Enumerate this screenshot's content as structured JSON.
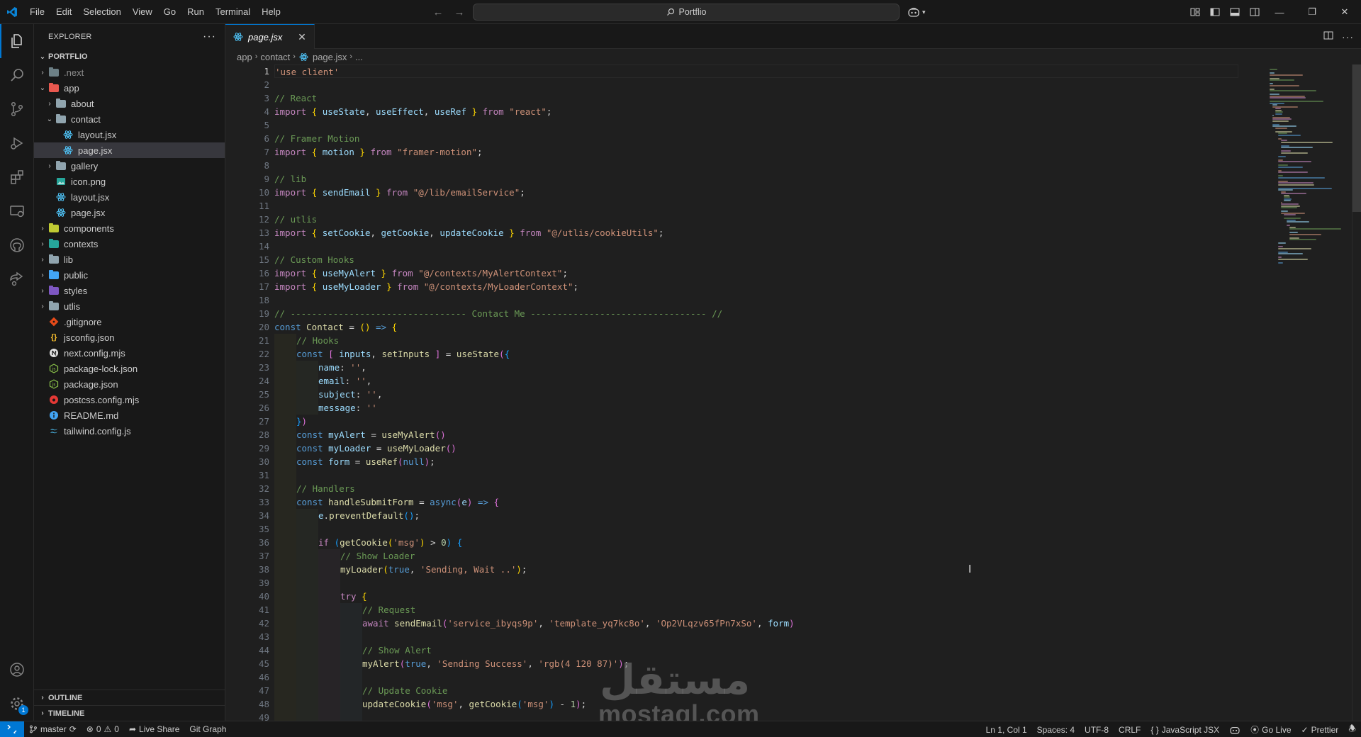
{
  "titlebar": {
    "menu": [
      "File",
      "Edit",
      "Selection",
      "View",
      "Go",
      "Run",
      "Terminal",
      "Help"
    ],
    "search": "Portflio"
  },
  "explorer": {
    "title": "EXPLORER",
    "more": "···",
    "project": "PORTFLIO",
    "tree": [
      {
        "name": ".next",
        "level": 0,
        "type": "folder",
        "color": "#6d8086",
        "chev": "right",
        "dim": true
      },
      {
        "name": "app",
        "level": 0,
        "type": "folder",
        "color": "#e8584f",
        "chev": "down"
      },
      {
        "name": "about",
        "level": 1,
        "type": "folder",
        "color": "#90a4ae",
        "chev": "right"
      },
      {
        "name": "contact",
        "level": 1,
        "type": "folder",
        "color": "#90a4ae",
        "chev": "down"
      },
      {
        "name": "layout.jsx",
        "level": 2,
        "type": "react"
      },
      {
        "name": "page.jsx",
        "level": 2,
        "type": "react",
        "selected": true
      },
      {
        "name": "gallery",
        "level": 1,
        "type": "folder",
        "color": "#90a4ae",
        "chev": "right"
      },
      {
        "name": "icon.png",
        "level": 1,
        "type": "image"
      },
      {
        "name": "layout.jsx",
        "level": 1,
        "type": "react"
      },
      {
        "name": "page.jsx",
        "level": 1,
        "type": "react"
      },
      {
        "name": "components",
        "level": 0,
        "type": "folder",
        "color": "#c0ca33",
        "chev": "right"
      },
      {
        "name": "contexts",
        "level": 0,
        "type": "folder",
        "color": "#26a69a",
        "chev": "right"
      },
      {
        "name": "lib",
        "level": 0,
        "type": "folder",
        "color": "#90a4ae",
        "chev": "right"
      },
      {
        "name": "public",
        "level": 0,
        "type": "folder",
        "color": "#42a5f5",
        "chev": "right"
      },
      {
        "name": "styles",
        "level": 0,
        "type": "folder",
        "color": "#7e57c2",
        "chev": "right"
      },
      {
        "name": "utlis",
        "level": 0,
        "type": "folder",
        "color": "#90a4ae",
        "chev": "right"
      },
      {
        "name": ".gitignore",
        "level": 0,
        "type": "git"
      },
      {
        "name": "jsconfig.json",
        "level": 0,
        "type": "json"
      },
      {
        "name": "next.config.mjs",
        "level": 0,
        "type": "next"
      },
      {
        "name": "package-lock.json",
        "level": 0,
        "type": "npm"
      },
      {
        "name": "package.json",
        "level": 0,
        "type": "npm"
      },
      {
        "name": "postcss.config.mjs",
        "level": 0,
        "type": "postcss"
      },
      {
        "name": "README.md",
        "level": 0,
        "type": "info"
      },
      {
        "name": "tailwind.config.js",
        "level": 0,
        "type": "tailwind"
      }
    ],
    "outline": "OUTLINE",
    "timeline": "TIMELINE"
  },
  "tab": {
    "label": "page.jsx"
  },
  "breadcrumb": [
    "app",
    "contact",
    "page.jsx",
    "..."
  ],
  "editor": {
    "current_line": 1,
    "lines": [
      {
        "i": 0,
        "t": [
          [
            "s",
            "'use client'"
          ]
        ]
      },
      {
        "i": 0,
        "t": []
      },
      {
        "i": 0,
        "t": [
          [
            "c",
            "// React"
          ]
        ]
      },
      {
        "i": 0,
        "t": [
          [
            "f",
            "import "
          ],
          [
            "b1",
            "{ "
          ],
          [
            "v",
            "useState"
          ],
          [
            "p",
            ", "
          ],
          [
            "v",
            "useEffect"
          ],
          [
            "p",
            ", "
          ],
          [
            "v",
            "useRef"
          ],
          [
            "b1",
            " } "
          ],
          [
            "f",
            "from "
          ],
          [
            "s",
            "\"react\""
          ],
          [
            "p",
            ";"
          ]
        ]
      },
      {
        "i": 0,
        "t": []
      },
      {
        "i": 0,
        "t": [
          [
            "c",
            "// Framer Motion"
          ]
        ]
      },
      {
        "i": 0,
        "t": [
          [
            "f",
            "import "
          ],
          [
            "b1",
            "{ "
          ],
          [
            "v",
            "motion"
          ],
          [
            "b1",
            " } "
          ],
          [
            "f",
            "from "
          ],
          [
            "s",
            "\"framer-motion\""
          ],
          [
            "p",
            ";"
          ]
        ]
      },
      {
        "i": 0,
        "t": []
      },
      {
        "i": 0,
        "t": [
          [
            "c",
            "// lib"
          ]
        ]
      },
      {
        "i": 0,
        "t": [
          [
            "f",
            "import "
          ],
          [
            "b1",
            "{ "
          ],
          [
            "v",
            "sendEmail"
          ],
          [
            "b1",
            " } "
          ],
          [
            "f",
            "from "
          ],
          [
            "s",
            "\"@/lib/emailService\""
          ],
          [
            "p",
            ";"
          ]
        ]
      },
      {
        "i": 0,
        "t": []
      },
      {
        "i": 0,
        "t": [
          [
            "c",
            "// utlis"
          ]
        ]
      },
      {
        "i": 0,
        "t": [
          [
            "f",
            "import "
          ],
          [
            "b1",
            "{ "
          ],
          [
            "v",
            "setCookie"
          ],
          [
            "p",
            ", "
          ],
          [
            "v",
            "getCookie"
          ],
          [
            "p",
            ", "
          ],
          [
            "v",
            "updateCookie"
          ],
          [
            "b1",
            " } "
          ],
          [
            "f",
            "from "
          ],
          [
            "s",
            "\"@/utlis/cookieUtils\""
          ],
          [
            "p",
            ";"
          ]
        ]
      },
      {
        "i": 0,
        "t": []
      },
      {
        "i": 0,
        "t": [
          [
            "c",
            "// Custom Hooks"
          ]
        ]
      },
      {
        "i": 0,
        "t": [
          [
            "f",
            "import "
          ],
          [
            "b1",
            "{ "
          ],
          [
            "v",
            "useMyAlert"
          ],
          [
            "b1",
            " } "
          ],
          [
            "f",
            "from "
          ],
          [
            "s",
            "\"@/contexts/MyAlertContext\""
          ],
          [
            "p",
            ";"
          ]
        ]
      },
      {
        "i": 0,
        "t": [
          [
            "f",
            "import "
          ],
          [
            "b1",
            "{ "
          ],
          [
            "v",
            "useMyLoader"
          ],
          [
            "b1",
            " } "
          ],
          [
            "f",
            "from "
          ],
          [
            "s",
            "\"@/contexts/MyLoaderContext\""
          ],
          [
            "p",
            ";"
          ]
        ]
      },
      {
        "i": 0,
        "t": []
      },
      {
        "i": 0,
        "t": [
          [
            "c",
            "// --------------------------------- Contact Me --------------------------------- //"
          ]
        ]
      },
      {
        "i": 0,
        "t": [
          [
            "k",
            "const "
          ],
          [
            "fn",
            "Contact"
          ],
          [
            "p",
            " = "
          ],
          [
            "b1",
            "()"
          ],
          [
            "p",
            " "
          ],
          [
            "k",
            "=>"
          ],
          [
            "p",
            " "
          ],
          [
            "b1",
            "{"
          ]
        ]
      },
      {
        "i": 1,
        "t": [
          [
            "c",
            "// Hooks"
          ]
        ]
      },
      {
        "i": 1,
        "t": [
          [
            "k",
            "const "
          ],
          [
            "b2",
            "[ "
          ],
          [
            "v",
            "inputs"
          ],
          [
            "p",
            ", "
          ],
          [
            "fn",
            "setInputs"
          ],
          [
            "b2",
            " ]"
          ],
          [
            "p",
            " = "
          ],
          [
            "fn",
            "useState"
          ],
          [
            "b2",
            "("
          ],
          [
            "b3",
            "{"
          ]
        ]
      },
      {
        "i": 2,
        "t": [
          [
            "v",
            "name"
          ],
          [
            "p",
            ": "
          ],
          [
            "s",
            "''"
          ],
          [
            "p",
            ","
          ]
        ]
      },
      {
        "i": 2,
        "t": [
          [
            "v",
            "email"
          ],
          [
            "p",
            ": "
          ],
          [
            "s",
            "''"
          ],
          [
            "p",
            ","
          ]
        ]
      },
      {
        "i": 2,
        "t": [
          [
            "v",
            "subject"
          ],
          [
            "p",
            ": "
          ],
          [
            "s",
            "''"
          ],
          [
            "p",
            ","
          ]
        ]
      },
      {
        "i": 2,
        "t": [
          [
            "v",
            "message"
          ],
          [
            "p",
            ": "
          ],
          [
            "s",
            "''"
          ]
        ]
      },
      {
        "i": 1,
        "t": [
          [
            "b3",
            "}"
          ],
          [
            "b2",
            ")"
          ]
        ]
      },
      {
        "i": 1,
        "t": [
          [
            "k",
            "const "
          ],
          [
            "v",
            "myAlert"
          ],
          [
            "p",
            " = "
          ],
          [
            "fn",
            "useMyAlert"
          ],
          [
            "b2",
            "()"
          ]
        ]
      },
      {
        "i": 1,
        "t": [
          [
            "k",
            "const "
          ],
          [
            "v",
            "myLoader"
          ],
          [
            "p",
            " = "
          ],
          [
            "fn",
            "useMyLoader"
          ],
          [
            "b2",
            "()"
          ]
        ]
      },
      {
        "i": 1,
        "t": [
          [
            "k",
            "const "
          ],
          [
            "v",
            "form"
          ],
          [
            "p",
            " = "
          ],
          [
            "fn",
            "useRef"
          ],
          [
            "b2",
            "("
          ],
          [
            "k",
            "null"
          ],
          [
            "b2",
            ")"
          ],
          [
            "p",
            ";"
          ]
        ]
      },
      {
        "i": 1,
        "t": []
      },
      {
        "i": 1,
        "t": [
          [
            "c",
            "// Handlers"
          ]
        ]
      },
      {
        "i": 1,
        "t": [
          [
            "k",
            "const "
          ],
          [
            "fn",
            "handleSubmitForm"
          ],
          [
            "p",
            " = "
          ],
          [
            "k",
            "async"
          ],
          [
            "b2",
            "("
          ],
          [
            "v",
            "e"
          ],
          [
            "b2",
            ")"
          ],
          [
            "p",
            " "
          ],
          [
            "k",
            "=>"
          ],
          [
            "p",
            " "
          ],
          [
            "b2",
            "{"
          ]
        ]
      },
      {
        "i": 2,
        "t": [
          [
            "v",
            "e"
          ],
          [
            "p",
            "."
          ],
          [
            "fn",
            "preventDefault"
          ],
          [
            "b3",
            "()"
          ],
          [
            "p",
            ";"
          ]
        ]
      },
      {
        "i": 2,
        "t": []
      },
      {
        "i": 2,
        "t": [
          [
            "f",
            "if "
          ],
          [
            "b3",
            "("
          ],
          [
            "fn",
            "getCookie"
          ],
          [
            "b1",
            "("
          ],
          [
            "s",
            "'msg'"
          ],
          [
            "b1",
            ")"
          ],
          [
            "p",
            " > "
          ],
          [
            "n",
            "0"
          ],
          [
            "b3",
            ")"
          ],
          [
            "p",
            " "
          ],
          [
            "b3",
            "{"
          ]
        ]
      },
      {
        "i": 3,
        "t": [
          [
            "c",
            "// Show Loader"
          ]
        ]
      },
      {
        "i": 3,
        "t": [
          [
            "fn",
            "myLoader"
          ],
          [
            "b1",
            "("
          ],
          [
            "k",
            "true"
          ],
          [
            "p",
            ", "
          ],
          [
            "s",
            "'Sending, Wait ..'"
          ],
          [
            "b1",
            ")"
          ],
          [
            "p",
            ";"
          ]
        ]
      },
      {
        "i": 3,
        "t": []
      },
      {
        "i": 3,
        "t": [
          [
            "f",
            "try "
          ],
          [
            "b1",
            "{"
          ]
        ]
      },
      {
        "i": 4,
        "t": [
          [
            "c",
            "// Request"
          ]
        ]
      },
      {
        "i": 4,
        "t": [
          [
            "f",
            "await "
          ],
          [
            "fn",
            "sendEmail"
          ],
          [
            "b2",
            "("
          ],
          [
            "s",
            "'service_ibyqs9p'"
          ],
          [
            "p",
            ", "
          ],
          [
            "s",
            "'template_yq7kc8o'"
          ],
          [
            "p",
            ", "
          ],
          [
            "s",
            "'Op2VLqzv65fPn7xSo'"
          ],
          [
            "p",
            ", "
          ],
          [
            "v",
            "form"
          ],
          [
            "b2",
            ")"
          ]
        ]
      },
      {
        "i": 4,
        "t": []
      },
      {
        "i": 4,
        "t": [
          [
            "c",
            "// Show Alert"
          ]
        ]
      },
      {
        "i": 4,
        "t": [
          [
            "fn",
            "myAlert"
          ],
          [
            "b2",
            "("
          ],
          [
            "k",
            "true"
          ],
          [
            "p",
            ", "
          ],
          [
            "s",
            "'Sending Success'"
          ],
          [
            "p",
            ", "
          ],
          [
            "s",
            "'rgb(4 120 87)'"
          ],
          [
            "b2",
            ")"
          ],
          [
            "p",
            ";"
          ]
        ]
      },
      {
        "i": 4,
        "t": []
      },
      {
        "i": 4,
        "t": [
          [
            "c",
            "// Update Cookie"
          ]
        ]
      },
      {
        "i": 4,
        "t": [
          [
            "fn",
            "updateCookie"
          ],
          [
            "b2",
            "("
          ],
          [
            "s",
            "'msg'"
          ],
          [
            "p",
            ", "
          ],
          [
            "fn",
            "getCookie"
          ],
          [
            "b3",
            "("
          ],
          [
            "s",
            "'msg'"
          ],
          [
            "b3",
            ")"
          ],
          [
            "p",
            " - "
          ],
          [
            "n",
            "1"
          ],
          [
            "b2",
            ")"
          ],
          [
            "p",
            ";"
          ]
        ]
      },
      {
        "i": 4,
        "t": []
      }
    ]
  },
  "watermark": {
    "arabic": "مستقل",
    "latin": "mostaql.com"
  },
  "statusbar": {
    "branch": "master",
    "errors": "0",
    "warnings": "0",
    "live_share": "Live Share",
    "git_graph": "Git Graph",
    "position": "Ln 1, Col 1",
    "spaces": "Spaces: 4",
    "encoding": "UTF-8",
    "eol": "CRLF",
    "language": "JavaScript JSX",
    "go_live": "Go Live",
    "prettier": "Prettier"
  },
  "colors": {
    "accent": "#0078d4",
    "react": "#4fc3f7"
  }
}
